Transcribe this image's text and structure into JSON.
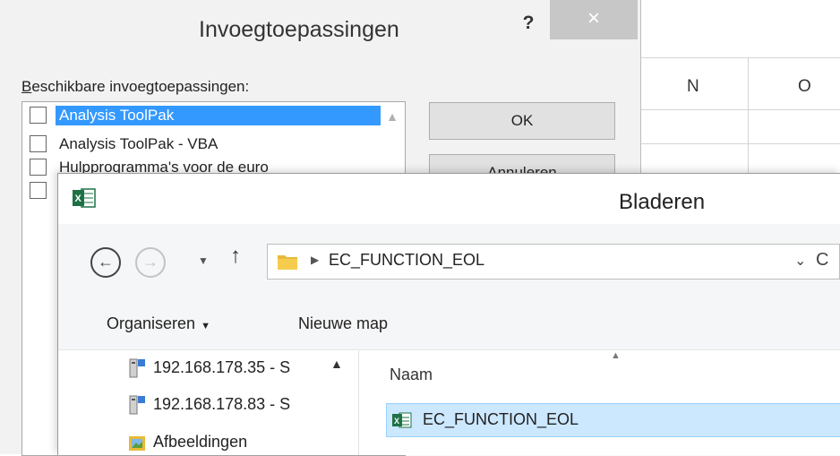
{
  "spreadsheet": {
    "columns": [
      "N",
      "O"
    ]
  },
  "addins_dialog": {
    "title": "Invoegtoepassingen",
    "help_label": "?",
    "close_label": "×",
    "available_label_underlined": "B",
    "available_label_rest": "eschikbare invoegtoepassingen:",
    "items": [
      {
        "label": "Analysis ToolPak",
        "checked": false,
        "selected": true
      },
      {
        "label": "Analysis ToolPak - VBA",
        "checked": false,
        "selected": false
      },
      {
        "label": "Hulpprogramma's voor de euro",
        "checked": false,
        "selected": false
      },
      {
        "label": "",
        "checked": false,
        "selected": false
      }
    ],
    "ok_label": "OK",
    "cancel_label": "Annuleren"
  },
  "browse_dialog": {
    "title": "Bladeren",
    "back_icon": "back-arrow-icon",
    "forward_icon": "forward-arrow-icon",
    "address_path": "EC_FUNCTION_EOL",
    "toolbar": {
      "organize_label": "Organiseren",
      "new_folder_label": "Nieuwe map"
    },
    "nav_items": [
      {
        "label": "192.168.178.35 - S",
        "icon": "network-drive-icon"
      },
      {
        "label": "192.168.178.83 - S",
        "icon": "network-drive-icon"
      },
      {
        "label": "Afbeeldingen",
        "icon": "pictures-folder-icon"
      }
    ],
    "column_name_label": "Naam",
    "files": [
      {
        "name": "EC_FUNCTION_EOL",
        "icon": "excel-file-icon"
      }
    ],
    "colors": {
      "selection": "#cce8ff",
      "selection_border": "#99d1ff",
      "excel_green": "#1e7145"
    }
  }
}
